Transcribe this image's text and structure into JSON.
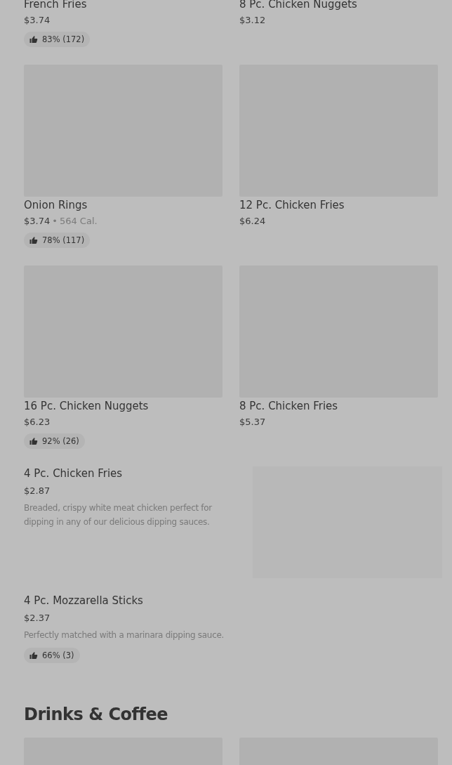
{
  "grid_items": [
    {
      "kind": "text_only",
      "name": "French Fries",
      "price": "$3.74",
      "rating": "83% (172)"
    },
    {
      "kind": "text_only",
      "name": "8 Pc. Chicken Nuggets",
      "price": "$3.12"
    },
    {
      "kind": "with_image",
      "name": "Onion Rings",
      "price": "$3.74",
      "separator": "•",
      "calories": "564 Cal.",
      "rating": "78% (117)"
    },
    {
      "kind": "with_image",
      "name": "12 Pc. Chicken Fries",
      "price": "$6.24"
    },
    {
      "kind": "with_image",
      "name": "16 Pc. Chicken Nuggets",
      "price": "$6.23",
      "rating": "92% (26)"
    },
    {
      "kind": "with_image",
      "name": "8 Pc. Chicken Fries",
      "price": "$5.37"
    }
  ],
  "list_items": [
    {
      "kind": "with_image",
      "name": "4 Pc. Chicken Fries",
      "price": "$2.87",
      "description": "Breaded, crispy white meat chicken perfect for dipping in any of our delicious dipping sauces."
    },
    {
      "kind": "text_only",
      "name": "4 Pc. Mozzarella Sticks",
      "price": "$2.37",
      "description": "Perfectly matched with a marinara dipping sauce.",
      "rating": "66% (3)"
    }
  ],
  "section": {
    "title": "Drinks & Coffee"
  }
}
